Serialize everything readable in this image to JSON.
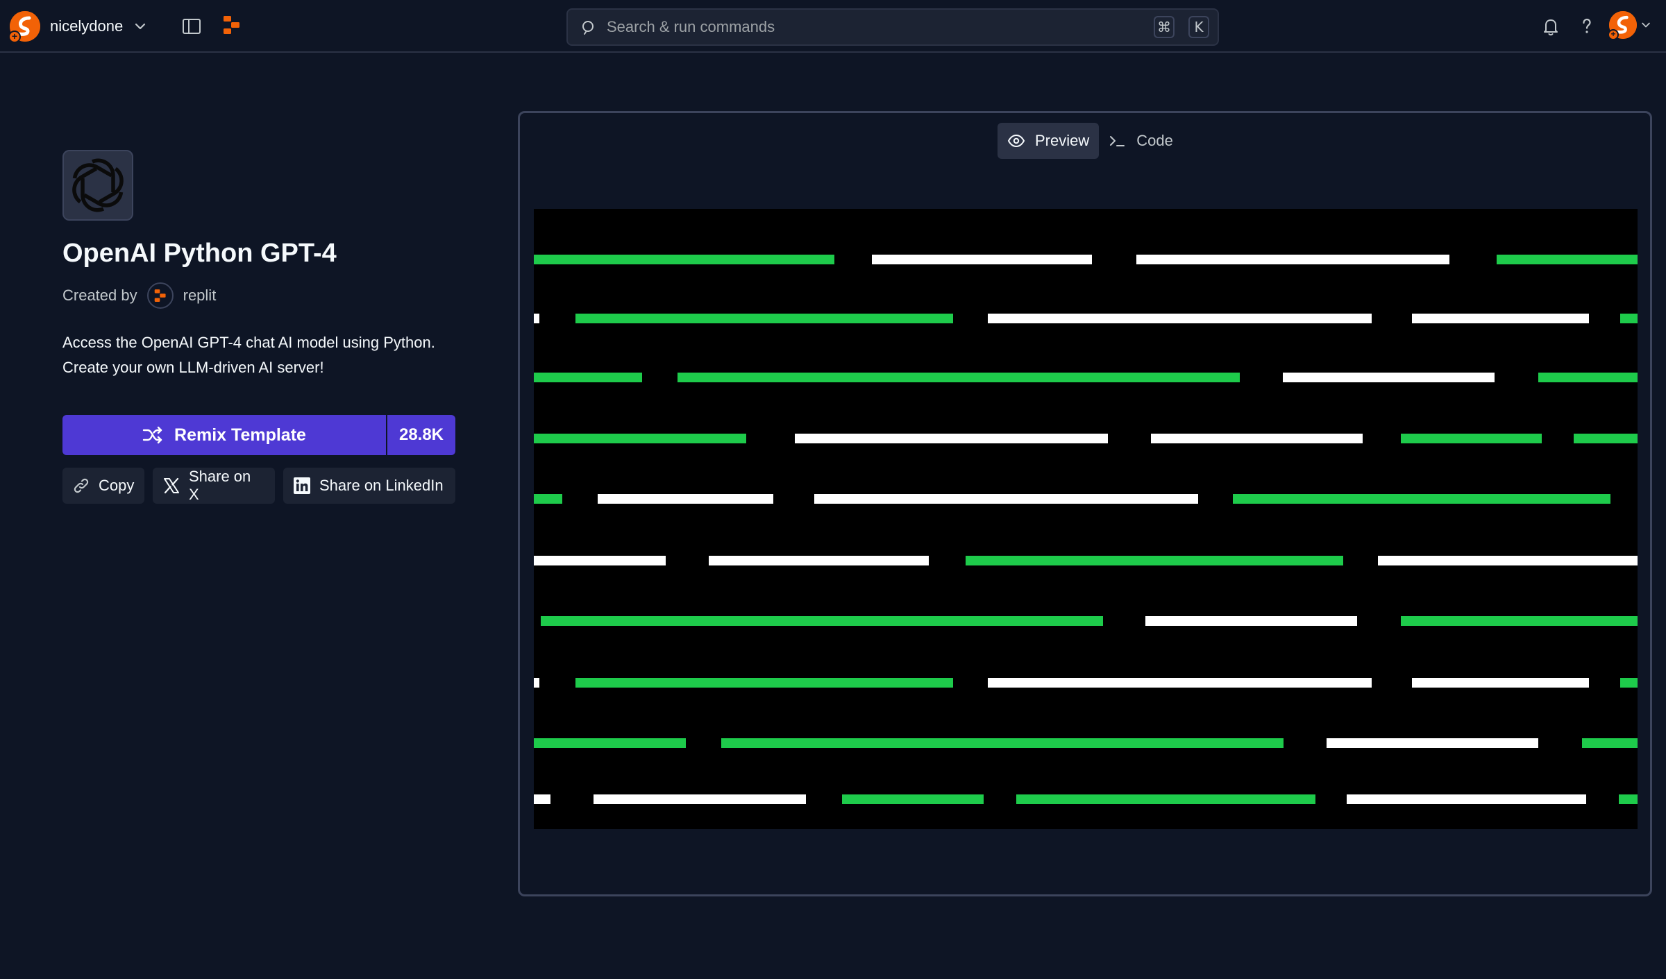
{
  "topbar": {
    "username": "nicelydone",
    "search_placeholder": "Search & run commands",
    "shortcut_keys": [
      "⌘",
      "K"
    ],
    "icons": {
      "user_avatar": "replit-user-avatar",
      "dropdown": "chevron-down-icon",
      "sidebar_toggle": "sidebar-toggle-icon",
      "home": "replit-logo-icon",
      "search": "search-icon",
      "notifications": "bell-icon",
      "help": "question-icon"
    }
  },
  "template": {
    "title": "OpenAI Python GPT-4",
    "created_by_label": "Created by",
    "creator": "replit",
    "description_line1": "Access the OpenAI GPT-4 chat AI model using Python.",
    "description_line2": "Create your own LLM-driven AI server!",
    "remix_label": "Remix Template",
    "remix_count": "28.8K",
    "copy_label": "Copy",
    "share_x_label": "Share on X",
    "share_linkedin_label": "Share on LinkedIn"
  },
  "preview": {
    "tabs": [
      {
        "label": "Preview",
        "active": true,
        "icon": "eye-icon"
      },
      {
        "label": "Code",
        "active": false,
        "icon": "terminal-icon"
      }
    ],
    "bar_colors": {
      "green": "#1ecb4b",
      "white": "#ffffff"
    }
  },
  "colors": {
    "background": "#0e1525",
    "accent": "#4e39d4",
    "brand_orange": "#f26207",
    "surface": "#1c2333",
    "border": "#2b3245"
  }
}
